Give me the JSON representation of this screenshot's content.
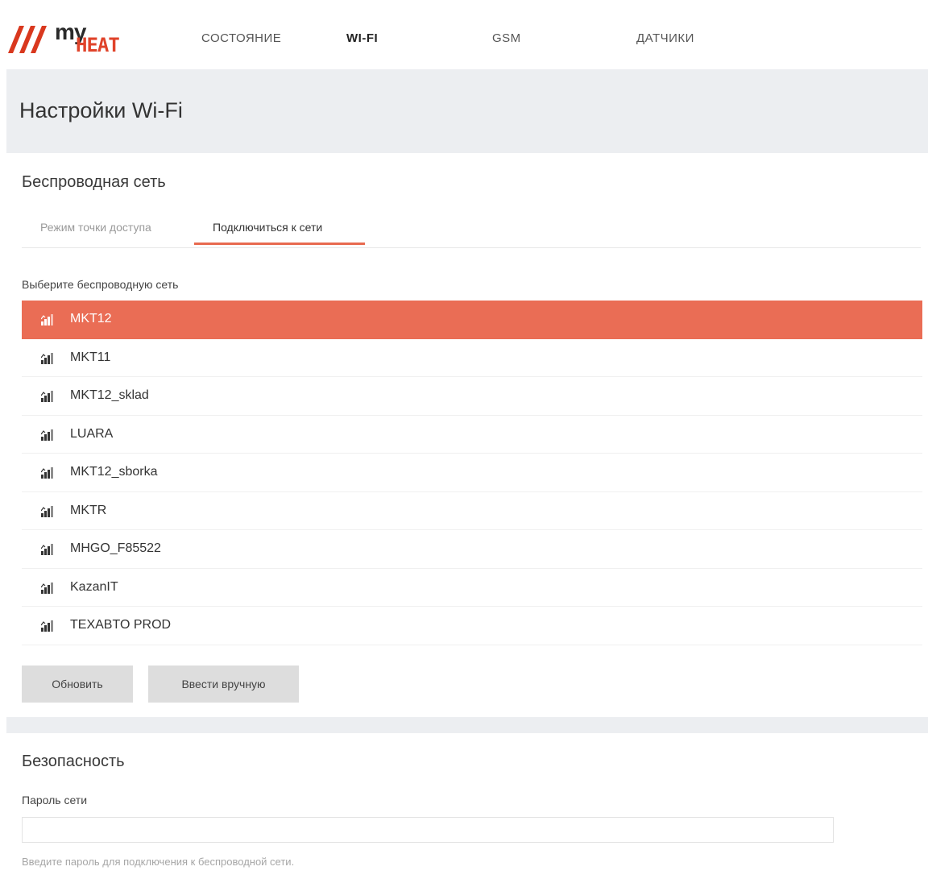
{
  "brand": {
    "logo_text_my": "my",
    "logo_text_heat": "HEAT",
    "accent_color": "#ea6d55"
  },
  "nav": {
    "items": [
      {
        "label": "СОСТОЯНИЕ",
        "active": false
      },
      {
        "label": "WI-FI",
        "active": true
      },
      {
        "label": "GSM",
        "active": false
      },
      {
        "label": "ДАТЧИКИ",
        "active": false
      }
    ]
  },
  "page": {
    "title": "Настройки Wi-Fi"
  },
  "wireless": {
    "heading": "Беспроводная сеть",
    "tabs": [
      {
        "label": "Режим точки доступа",
        "active": false
      },
      {
        "label": "Подключиться к сети",
        "active": true
      }
    ],
    "select_label": "Выберите беспроводную сеть",
    "networks": [
      {
        "ssid": "MKT12",
        "selected": true,
        "icon": "wifi-signal-icon"
      },
      {
        "ssid": "MKT11",
        "selected": false,
        "icon": "wifi-signal-icon"
      },
      {
        "ssid": "MKT12_sklad",
        "selected": false,
        "icon": "wifi-signal-icon"
      },
      {
        "ssid": "LUARA",
        "selected": false,
        "icon": "wifi-signal-icon"
      },
      {
        "ssid": "MKT12_sborka",
        "selected": false,
        "icon": "wifi-signal-icon"
      },
      {
        "ssid": "MKTR",
        "selected": false,
        "icon": "wifi-signal-icon"
      },
      {
        "ssid": "MHGO_F85522",
        "selected": false,
        "icon": "wifi-signal-icon"
      },
      {
        "ssid": "KazanIT",
        "selected": false,
        "icon": "wifi-signal-icon"
      },
      {
        "ssid": "TEXABTO PROD",
        "selected": false,
        "icon": "wifi-signal-icon"
      }
    ],
    "refresh_label": "Обновить",
    "manual_label": "Ввести вручную"
  },
  "security": {
    "heading": "Безопасность",
    "password_label": "Пароль сети",
    "password_value": "",
    "help_text": "Введите пароль для подключения к беспроводной сети."
  }
}
